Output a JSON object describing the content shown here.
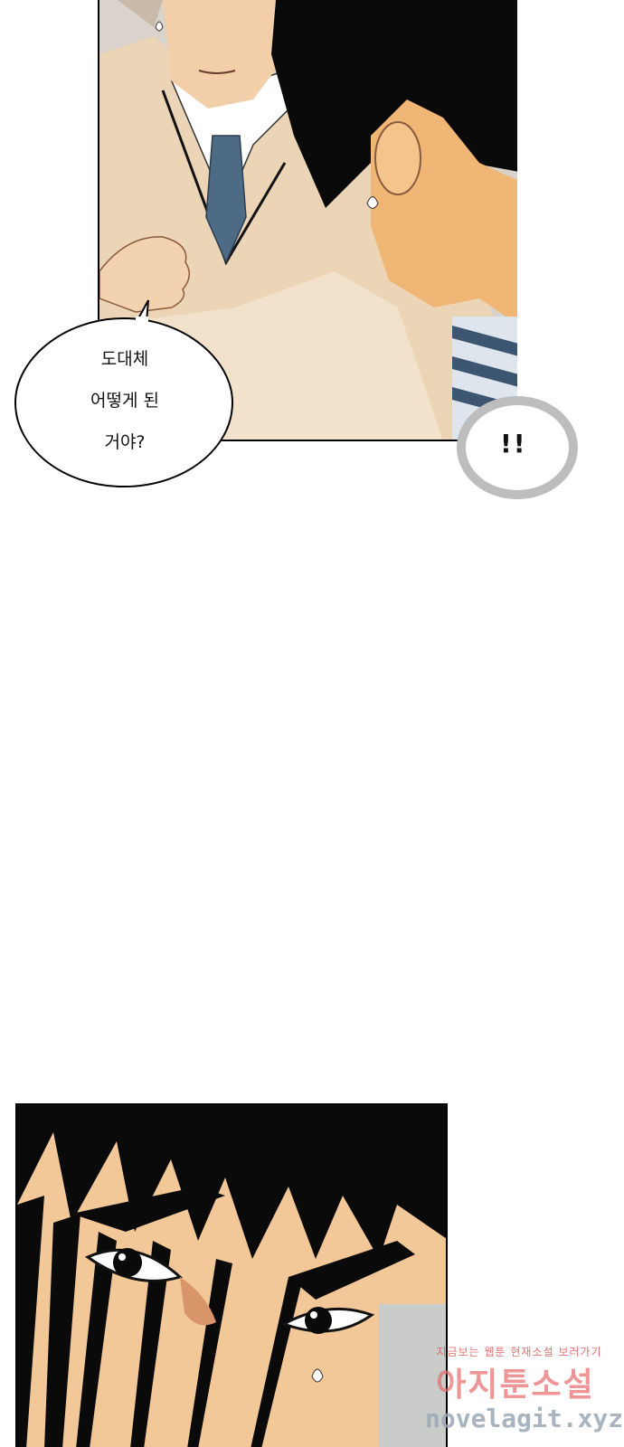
{
  "speech_bubble": {
    "line1": "도대체",
    "line2": "어떻게 된",
    "line3": "거야?"
  },
  "reaction_bubble": {
    "text": "!!"
  },
  "watermark": {
    "line1": "지금보는 웹툰 현재소설 보러가기",
    "line2": "아지툰소설",
    "line3": "novelagit.xyz"
  },
  "colors": {
    "skin": "#f2cfa8",
    "sweater": "#ecd4b6",
    "tie": "#4e6b86",
    "hair": "#0a0a0a",
    "watermark": "#e86a6a"
  }
}
